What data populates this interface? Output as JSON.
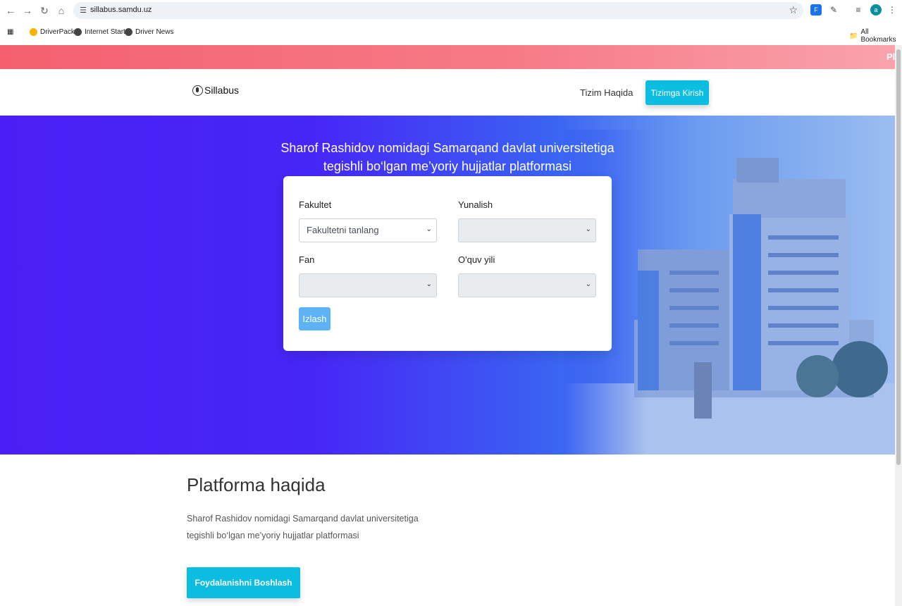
{
  "browser": {
    "url": "sillabus.samdu.uz",
    "bookmarks": [
      "DriverPack",
      "Internet Start",
      "Driver News"
    ],
    "all_bookmarks": "All Bookmarks",
    "avatar_letter": "a"
  },
  "promo": {
    "text": "Pl"
  },
  "navbar": {
    "logo_text": "Sillabus",
    "about_link": "Tizim Haqida",
    "login_button": "Tizimga Kirish"
  },
  "hero": {
    "title_line1": "Sharof Rashidov nomidagi Samarqand davlat universitetiga",
    "title_line2": "tegishli bo‘lgan me’yoriy hujjatlar platformasi"
  },
  "search_form": {
    "faculty_label": "Fakultet",
    "faculty_value": "Fakultetni tanlang",
    "direction_label": "Yunalish",
    "direction_value": "",
    "subject_label": "Fan",
    "subject_value": "",
    "year_label": "O'quv yili",
    "year_value": "",
    "search_button": "Izlash"
  },
  "about": {
    "title": "Platforma haqida",
    "text_line1": "Sharof Rashidov nomidagi Samarqand davlat universitetiga",
    "text_line2": "tegishli bo‘lgan me’yoriy hujjatlar platformasi",
    "start_button": "Foydalanishni Boshlash"
  },
  "colors": {
    "accent": "#0bbde0",
    "hero_start": "#4a1ff5",
    "promo": "#f4606e",
    "search_button": "#5eb3f6"
  }
}
